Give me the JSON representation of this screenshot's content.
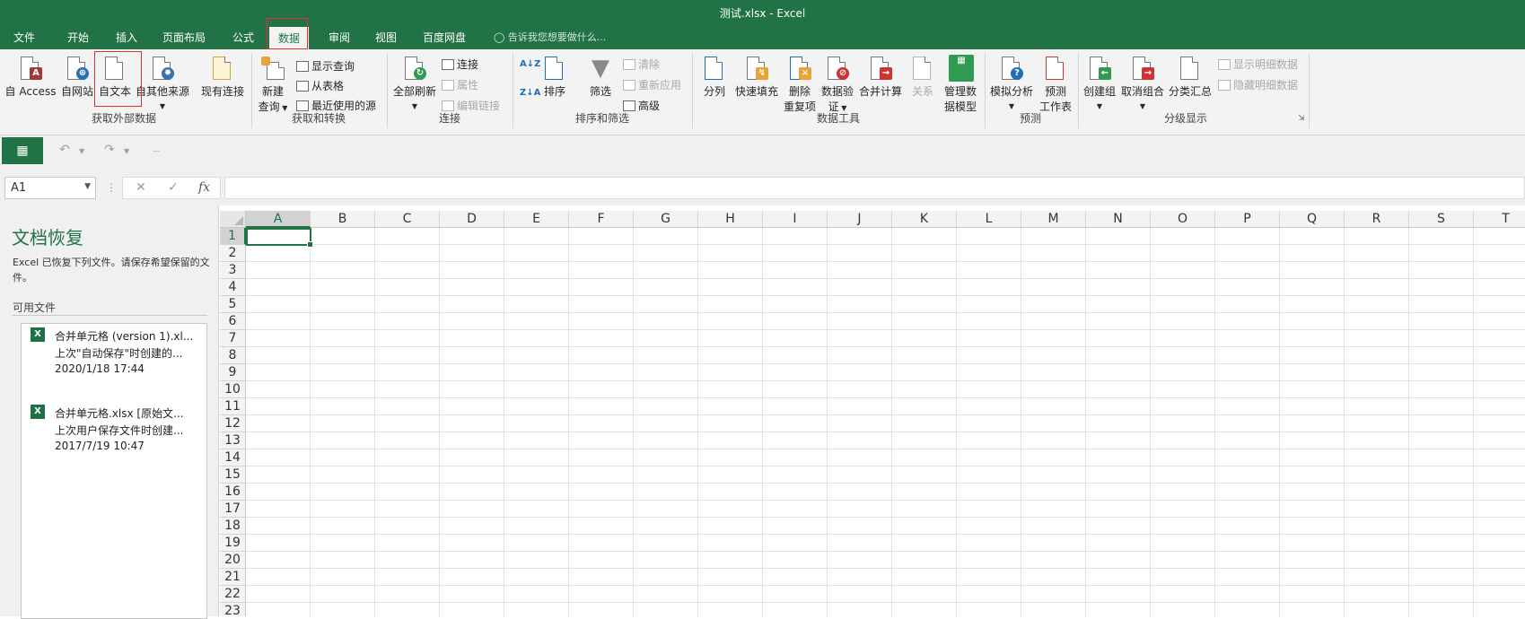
{
  "window": {
    "title": "测试.xlsx - Excel"
  },
  "tabs": [
    "文件",
    "开始",
    "插入",
    "页面布局",
    "公式",
    "数据",
    "审阅",
    "视图",
    "百度网盘"
  ],
  "active_tab": "数据",
  "tell_me": "告诉我您想要做什么...",
  "ribbon": {
    "external": {
      "from_access": "自 Access",
      "from_web": "自网站",
      "from_text": "自文本",
      "from_other": "自其他来源",
      "existing": "现有连接",
      "group": "获取外部数据"
    },
    "transform": {
      "new_query_1": "新建",
      "new_query_2": "查询",
      "show_queries": "显示查询",
      "from_table": "从表格",
      "recent_sources": "最近使用的源",
      "group": "获取和转换"
    },
    "connections": {
      "refresh_all": "全部刷新",
      "connections": "连接",
      "properties": "属性",
      "edit_links": "编辑链接",
      "group": "连接"
    },
    "sort_filter": {
      "sort": "排序",
      "filter": "筛选",
      "clear": "清除",
      "reapply": "重新应用",
      "advanced": "高级",
      "group": "排序和筛选"
    },
    "data_tools": {
      "text_to_columns": "分列",
      "flash_fill": "快速填充",
      "remove_dup_1": "删除",
      "remove_dup_2": "重复项",
      "validation_1": "数据验",
      "validation_2": "证",
      "consolidate": "合并计算",
      "relationships": "关系",
      "data_model_1": "管理数",
      "data_model_2": "据模型",
      "group": "数据工具"
    },
    "forecast": {
      "what_if": "模拟分析",
      "forecast_1": "预测",
      "forecast_2": "工作表",
      "group": "预测"
    },
    "outline": {
      "group_btn": "创建组",
      "ungroup": "取消组合",
      "subtotal": "分类汇总",
      "show_detail": "显示明细数据",
      "hide_detail": "隐藏明细数据",
      "group": "分级显示"
    }
  },
  "name_box": "A1",
  "recovery": {
    "title": "文档恢复",
    "description": "Excel 已恢复下列文件。请保存希望保留的文件。",
    "available_label": "可用文件",
    "files": [
      {
        "name": "合并单元格 (version 1).xl...",
        "desc": "上次\"自动保存\"时创建的...",
        "time": "2020/1/18 17:44"
      },
      {
        "name": "合并单元格.xlsx  [原始文...",
        "desc": "上次用户保存文件时创建...",
        "time": "2017/7/19 10:47"
      }
    ]
  },
  "columns": [
    "A",
    "B",
    "C",
    "D",
    "E",
    "F",
    "G",
    "H",
    "I",
    "J",
    "K",
    "L",
    "M",
    "N",
    "O",
    "P",
    "Q",
    "R",
    "S",
    "T"
  ],
  "rows": [
    "1",
    "2",
    "3",
    "4",
    "5",
    "6",
    "7",
    "8",
    "9",
    "10",
    "11",
    "12",
    "13",
    "14",
    "15",
    "16",
    "17",
    "18",
    "19",
    "20",
    "21",
    "22",
    "23"
  ],
  "selected_cell": "A1",
  "colors": {
    "accent": "#217346",
    "highlight_box": "#e03030"
  }
}
